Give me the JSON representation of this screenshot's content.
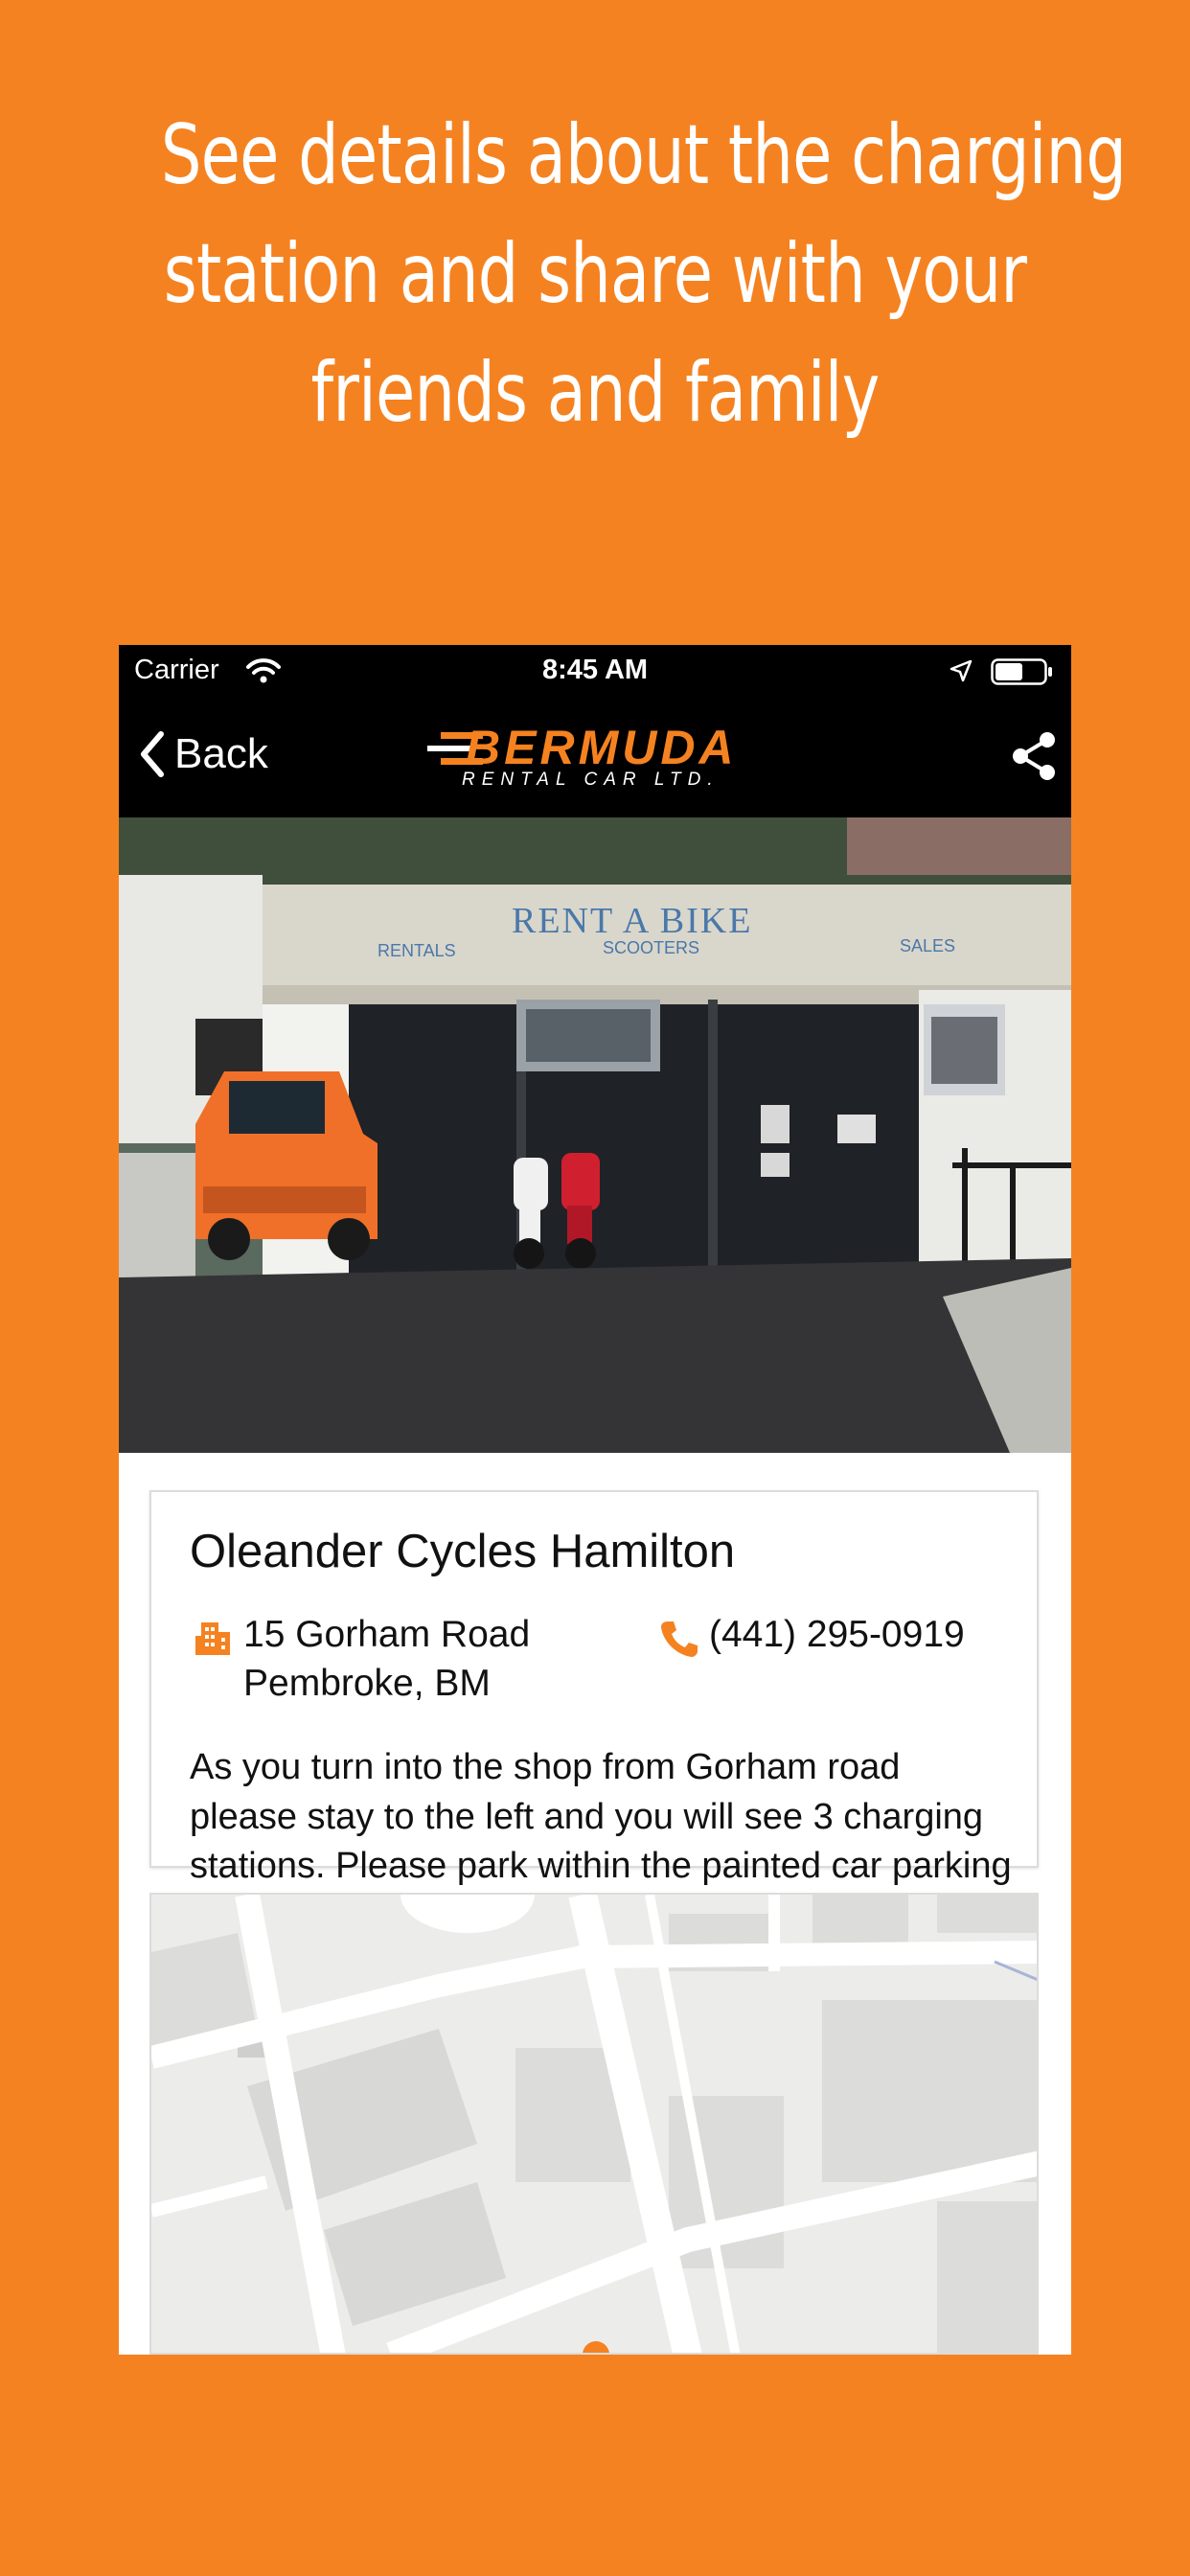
{
  "headline": {
    "lines": [
      "See details about the charging",
      "station and share with your",
      "friends and family"
    ]
  },
  "status_bar": {
    "carrier": "Carrier",
    "time": "8:45 AM",
    "icons": [
      "wifi-icon",
      "location-arrow-icon",
      "battery-icon"
    ]
  },
  "nav": {
    "back_label": "Back",
    "logo_main": "BERMUDA",
    "logo_sub": "RENTAL CAR LTD.",
    "share_icon": "share-icon"
  },
  "photo": {
    "sign_main": "RENT A BIKE",
    "sign_left": "RENTALS",
    "sign_center": "SCOOTERS",
    "sign_right": "SALES"
  },
  "station": {
    "name": "Oleander Cycles Hamilton",
    "address_line1": "15 Gorham Road",
    "address_line2": "Pembroke, BM",
    "phone": "(441) 295-0919",
    "description": "As you turn into the shop from Gorham road please stay to the left and you will see 3 charging stations. Please park within the painted car parking bays to allow other customers to park and charge as necessary."
  },
  "colors": {
    "brand_orange": "#F58220",
    "nav_background": "#000000",
    "text": "#111111"
  }
}
